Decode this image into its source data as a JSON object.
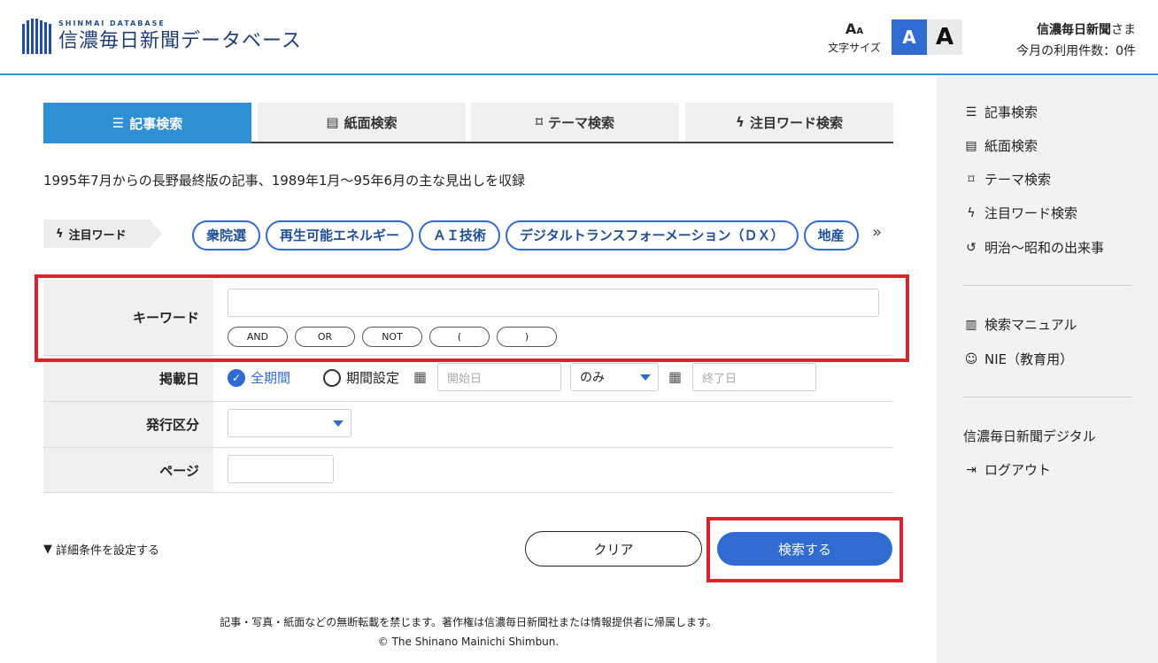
{
  "header": {
    "logo_sub": "SHINMAI DATABASE",
    "logo_main": "信濃毎日新聞データベース",
    "fontsize_label": "文字サイズ",
    "size_small": "A",
    "size_large": "A",
    "user_name": "信濃毎日新聞",
    "user_suffix": "さま",
    "usage": "今月の利用件数：0件"
  },
  "tabs": [
    {
      "label": "記事検索",
      "icon": "list-icon"
    },
    {
      "label": "紙面検索",
      "icon": "newspaper-icon"
    },
    {
      "label": "テーマ検索",
      "icon": "bookmark-icon"
    },
    {
      "label": "注目ワード検索",
      "icon": "lightning-icon"
    }
  ],
  "intro": "1995年7月からの長野最終版の記事、1989年1月～95年6月の主な見出しを収録",
  "trending": {
    "label": "注目ワード",
    "chips": [
      "衆院選",
      "再生可能エネルギー",
      "ＡＩ技術",
      "デジタルトランスフォーメーション（ＤＸ）",
      "地産"
    ],
    "more": "»"
  },
  "form": {
    "keyword_label": "キーワード",
    "ops": [
      "AND",
      "OR",
      "NOT",
      "(",
      ")"
    ],
    "date_label": "掲載日",
    "all_period": "全期間",
    "period_set": "期間設定",
    "start_placeholder": "開始日",
    "range_mode": "のみ",
    "end_placeholder": "終了日",
    "kind_label": "発行区分",
    "page_label": "ページ"
  },
  "actions": {
    "detail": "詳細条件を設定する",
    "clear": "クリア",
    "search": "検索する"
  },
  "sidebar": {
    "items": [
      {
        "label": "記事検索"
      },
      {
        "label": "紙面検索"
      },
      {
        "label": "テーマ検索"
      },
      {
        "label": "注目ワード検索"
      },
      {
        "label": "明治～昭和の出来事"
      },
      {
        "label": "検索マニュアル"
      },
      {
        "label": "NIE（教育用）"
      },
      {
        "label": "信濃毎日新聞デジタル"
      },
      {
        "label": "ログアウト"
      }
    ]
  },
  "footer": {
    "line1": "記事・写真・紙面などの無断転載を禁じます。著作権は信濃毎日新聞社または情報提供者に帰属します。",
    "line2": "© The Shinano Mainichi Shimbun."
  },
  "colors": {
    "accent": "#2f6bd1",
    "tab_active": "#2f8fd4",
    "highlight": "#d9232e"
  }
}
